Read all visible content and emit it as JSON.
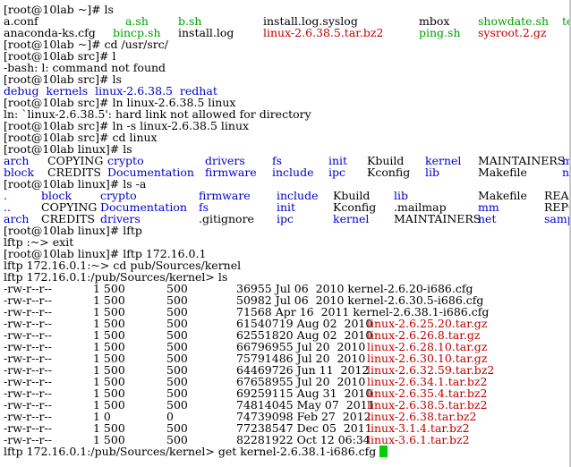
{
  "colors": {
    "default": "#000000",
    "dir": "#0000c8",
    "exec": "#00a000",
    "archive": "#c00000",
    "cursor": "#00d000"
  },
  "lines": [
    [
      {
        "t": "[root@10lab ~]# ls"
      }
    ],
    [
      {
        "t": "a.conf"
      },
      {
        "t": "a.sh",
        "c": "exec"
      },
      {
        "t": "b.sh",
        "c": "exec"
      },
      {
        "t": "install.log.syslog"
      },
      {
        "t": "mbox"
      },
      {
        "t": "showdate.sh",
        "c": "exec"
      },
      {
        "t": "test.sh",
        "c": "exec"
      }
    ],
    [
      {
        "t": "anaconda-ks.cfg"
      },
      {
        "t": "bincp.sh",
        "c": "exec"
      },
      {
        "t": "install.log"
      },
      {
        "t": "linux-2.6.38.5.tar.bz2",
        "c": "archive"
      },
      {
        "t": "ping.sh",
        "c": "exec"
      },
      {
        "t": "sysroot.2.gz",
        "c": "archive"
      }
    ],
    [
      {
        "t": "[root@10lab ~]# cd /usr/src/"
      }
    ],
    [
      {
        "t": "[root@10lab src]# l"
      }
    ],
    [
      {
        "t": "-bash: l: command not found"
      }
    ],
    [
      {
        "t": "[root@10lab src]# ls"
      }
    ],
    [
      {
        "t": "debug  kernels  linux-2.6.38.5  redhat",
        "c": "dir"
      }
    ],
    [
      {
        "t": "[root@10lab src]# ln linux-2.6.38.5 linux"
      }
    ],
    [
      {
        "t": "ln: `linux-2.6.38.5': hard link not allowed for directory"
      }
    ],
    [
      {
        "t": "[root@10lab src]# ln -s linux-2.6.38.5 linux"
      }
    ],
    [
      {
        "t": "[root@10lab src]# cd linux"
      }
    ],
    [
      {
        "t": "[root@10lab linux]# ls"
      }
    ],
    [
      {
        "t": "arch",
        "c": "dir"
      },
      {
        "t": "COPYING"
      },
      {
        "t": "crypto",
        "c": "dir"
      },
      {
        "t": "drivers",
        "c": "dir"
      },
      {
        "t": "fs",
        "c": "dir"
      },
      {
        "t": "init",
        "c": "dir"
      },
      {
        "t": "Kbuild"
      },
      {
        "t": "kernel",
        "c": "dir"
      },
      {
        "t": "MAINTAINERS"
      },
      {
        "t": "mm",
        "c": "dir"
      }
    ],
    [
      {
        "t": "block",
        "c": "dir"
      },
      {
        "t": "CREDITS"
      },
      {
        "t": "Documentation",
        "c": "dir"
      },
      {
        "t": "firmware",
        "c": "dir"
      },
      {
        "t": "include",
        "c": "dir"
      },
      {
        "t": "ipc",
        "c": "dir"
      },
      {
        "t": "Kconfig"
      },
      {
        "t": "lib",
        "c": "dir"
      },
      {
        "t": "Makefile"
      },
      {
        "t": "net",
        "c": "dir"
      }
    ],
    [
      {
        "t": "[root@10lab linux]# ls -a"
      }
    ],
    [
      {
        "t": ".",
        "c": "dir"
      },
      {
        "t": "block",
        "c": "dir"
      },
      {
        "t": "crypto",
        "c": "dir"
      },
      {
        "t": "firmware",
        "c": "dir"
      },
      {
        "t": "include",
        "c": "dir"
      },
      {
        "t": "Kbuild"
      },
      {
        "t": "lib",
        "c": "dir"
      },
      {
        "t": "Makefile"
      },
      {
        "t": "README"
      }
    ],
    [
      {
        "t": "..",
        "c": "dir"
      },
      {
        "t": "COPYING"
      },
      {
        "t": "Documentation",
        "c": "dir"
      },
      {
        "t": "fs",
        "c": "dir"
      },
      {
        "t": "init",
        "c": "dir"
      },
      {
        "t": "Kconfig"
      },
      {
        "t": ".mailmap"
      },
      {
        "t": "mm",
        "c": "dir"
      },
      {
        "t": "REPORTING"
      }
    ],
    [
      {
        "t": "arch",
        "c": "dir"
      },
      {
        "t": "CREDITS"
      },
      {
        "t": "drivers",
        "c": "dir"
      },
      {
        "t": ".gitignore"
      },
      {
        "t": "ipc",
        "c": "dir"
      },
      {
        "t": "kernel",
        "c": "dir"
      },
      {
        "t": "MAINTAINERS"
      },
      {
        "t": "net",
        "c": "dir"
      },
      {
        "t": "samples",
        "c": "dir"
      }
    ],
    [
      {
        "t": "[root@10lab linux]# lftp"
      }
    ],
    [
      {
        "t": "lftp :~> exit"
      }
    ],
    [
      {
        "t": "[root@10lab linux]# lftp 172.16.0.1"
      }
    ],
    [
      {
        "t": "lftp 172.16.0.1:~> cd pub/Sources/kernel"
      }
    ],
    [
      {
        "t": "lftp 172.16.0.1:/pub/Sources/kernel> ls"
      }
    ],
    [
      {
        "t": "-rw-r--r--"
      },
      {
        "t": "1 500"
      },
      {
        "t": "500"
      },
      {
        "t": "36955 Jul 06  2010 kernel-2.6.20-i686.cfg"
      }
    ],
    [
      {
        "t": "-rw-r--r--"
      },
      {
        "t": "1 500"
      },
      {
        "t": "500"
      },
      {
        "t": "50982 Jul 06  2010 kernel-2.6.30.5-i686.cfg"
      }
    ],
    [
      {
        "t": "-rw-r--r--"
      },
      {
        "t": "1 500"
      },
      {
        "t": "500"
      },
      {
        "t": "71568 Apr 16  2011 kernel-2.6.38.1-i686.cfg"
      }
    ],
    [
      {
        "t": "-rw-r--r--"
      },
      {
        "t": "1 500"
      },
      {
        "t": "500"
      },
      {
        "t": "61540719 Aug 02  2010"
      },
      {
        "t": "linux-2.6.25.20.tar.gz",
        "c": "archive"
      }
    ],
    [
      {
        "t": "-rw-r--r--"
      },
      {
        "t": "1 500"
      },
      {
        "t": "500"
      },
      {
        "t": "62551820 Aug 02  2010"
      },
      {
        "t": "linux-2.6.26.8.tar.gz",
        "c": "archive"
      }
    ],
    [
      {
        "t": "-rw-r--r--"
      },
      {
        "t": "1 500"
      },
      {
        "t": "500"
      },
      {
        "t": "66796955 Jul 20  2010"
      },
      {
        "t": "linux-2.6.28.10.tar.gz",
        "c": "archive"
      }
    ],
    [
      {
        "t": "-rw-r--r--"
      },
      {
        "t": "1 500"
      },
      {
        "t": "500"
      },
      {
        "t": "75791486 Jul 20  2010"
      },
      {
        "t": "linux-2.6.30.10.tar.gz",
        "c": "archive"
      }
    ],
    [
      {
        "t": "-rw-r--r--"
      },
      {
        "t": "1 500"
      },
      {
        "t": "500"
      },
      {
        "t": "64469726 Jun 11  2012"
      },
      {
        "t": "linux-2.6.32.59.tar.bz2",
        "c": "archive"
      }
    ],
    [
      {
        "t": "-rw-r--r--"
      },
      {
        "t": "1 500"
      },
      {
        "t": "500"
      },
      {
        "t": "67658955 Jul 20  2010"
      },
      {
        "t": "linux-2.6.34.1.tar.bz2",
        "c": "archive"
      }
    ],
    [
      {
        "t": "-rw-r--r--"
      },
      {
        "t": "1 500"
      },
      {
        "t": "500"
      },
      {
        "t": "69259115 Aug 31  2010"
      },
      {
        "t": "linux-2.6.35.4.tar.bz2",
        "c": "archive"
      }
    ],
    [
      {
        "t": "-rw-r--r--"
      },
      {
        "t": "1 500"
      },
      {
        "t": "500"
      },
      {
        "t": "74814045 May 07  2011"
      },
      {
        "t": "linux-2.6.38.5.tar.bz2",
        "c": "archive"
      }
    ],
    [
      {
        "t": "-rw-r--r--"
      },
      {
        "t": "1 0"
      },
      {
        "t": "0"
      },
      {
        "t": "74739098 Feb 27  2012"
      },
      {
        "t": "linux-2.6.38.tar.bz2",
        "c": "archive"
      }
    ],
    [
      {
        "t": "-rw-r--r--"
      },
      {
        "t": "1 500"
      },
      {
        "t": "500"
      },
      {
        "t": "77238547 Dec 05  2011"
      },
      {
        "t": "linux-3.1.4.tar.bz2",
        "c": "archive"
      }
    ],
    [
      {
        "t": "-rw-r--r--"
      },
      {
        "t": "1 500"
      },
      {
        "t": "500"
      },
      {
        "t": "82281922 Oct 12 06:34"
      },
      {
        "t": "linux-3.6.1.tar.bz2",
        "c": "archive"
      }
    ],
    [
      {
        "t": "lftp 172.16.0.1:/pub/Sources/kernel> get kernel-2.6.38.1-i686.cfg "
      }
    ]
  ]
}
